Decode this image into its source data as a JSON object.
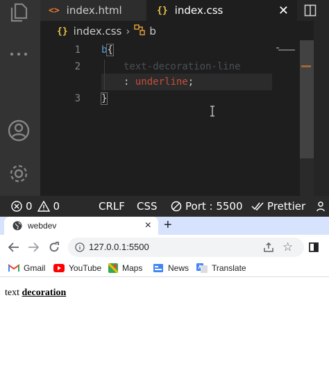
{
  "editor": {
    "tabs": [
      {
        "label": "index.html",
        "icon": "html-file-icon"
      },
      {
        "label": "index.css",
        "icon": "css-file-icon",
        "active": true
      }
    ],
    "breadcrumb": {
      "file": "index.css",
      "symbol": "b"
    },
    "line_numbers": [
      "1",
      "2",
      "3"
    ],
    "code": {
      "selector": "b",
      "open_brace": "{",
      "property": "text-decoration-line",
      "colon": ":",
      "value": "underline",
      "semicolon": ";",
      "close_brace": "}"
    },
    "colors": {
      "selector": "#569cd6",
      "property": "#9cdcfe",
      "value": "#ce9178",
      "brace": "#d4d4d4"
    }
  },
  "statusbar": {
    "errors": "0",
    "warnings": "0",
    "eol": "CRLF",
    "language": "CSS",
    "port": "Port : 5500",
    "prettier": "Prettier"
  },
  "browser": {
    "tab_title": "webdev",
    "new_tab": "+",
    "url": "127.0.0.1:5500",
    "bookmarks": [
      "Gmail",
      "YouTube",
      "Maps",
      "News",
      "Translate"
    ]
  },
  "page": {
    "plain_text": "text",
    "bold_text": "decoration"
  }
}
